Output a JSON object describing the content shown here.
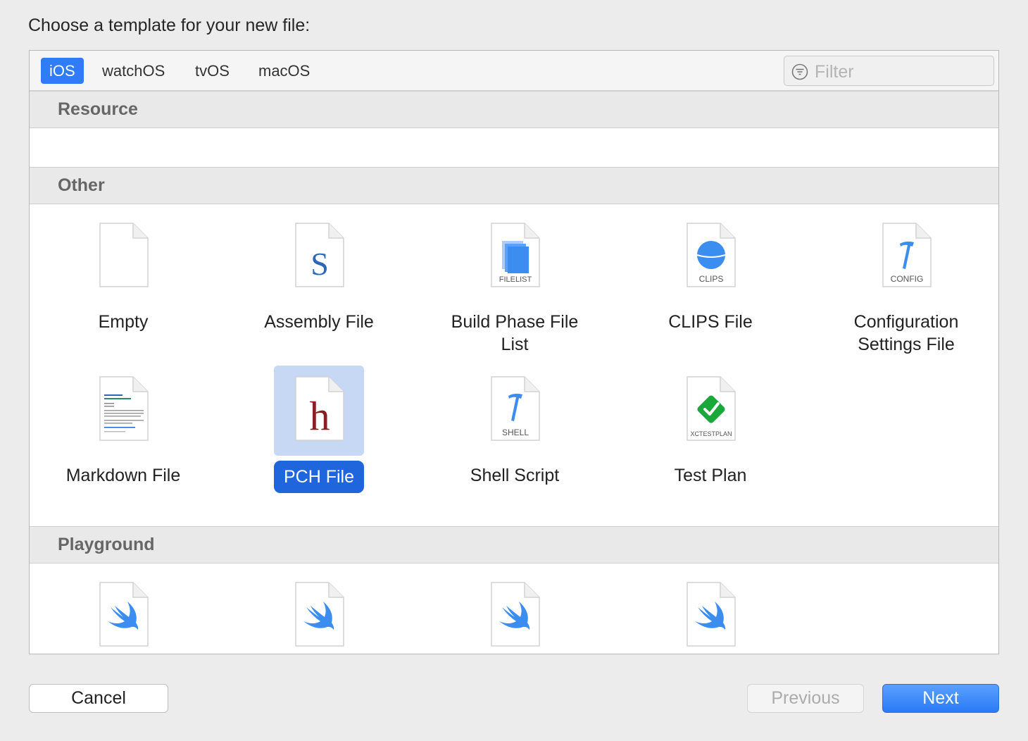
{
  "dialog": {
    "heading": "Choose a template for your new file:"
  },
  "platform_tabs": [
    {
      "label": "iOS",
      "selected": true
    },
    {
      "label": "watchOS",
      "selected": false
    },
    {
      "label": "tvOS",
      "selected": false
    },
    {
      "label": "macOS",
      "selected": false
    }
  ],
  "filter": {
    "placeholder": "Filter"
  },
  "sections": {
    "resource": "Resource",
    "other": "Other",
    "playground": "Playground"
  },
  "other_items": [
    {
      "label": "Empty",
      "icon": "empty-file-icon"
    },
    {
      "label": "Assembly File",
      "icon": "assembly-file-icon",
      "glyph": "S"
    },
    {
      "label": "Build Phase File List",
      "icon": "filelist-file-icon",
      "tag": "FILELIST"
    },
    {
      "label": "CLIPS File",
      "icon": "clips-file-icon",
      "tag": "CLIPS"
    },
    {
      "label": "Configuration Settings File",
      "icon": "config-file-icon",
      "tag": "CONFIG"
    },
    {
      "label": "Markdown File",
      "icon": "markdown-file-icon"
    },
    {
      "label": "PCH File",
      "icon": "pch-file-icon",
      "glyph": "h",
      "selected": true
    },
    {
      "label": "Shell Script",
      "icon": "shell-file-icon",
      "tag": "SHELL"
    },
    {
      "label": "Test Plan",
      "icon": "xctestplan-file-icon",
      "tag": "XCTESTPLAN"
    }
  ],
  "playground_items": [
    {
      "icon": "swift-file-icon"
    },
    {
      "icon": "swift-file-icon"
    },
    {
      "icon": "swift-file-icon"
    },
    {
      "icon": "swift-file-icon"
    }
  ],
  "buttons": {
    "cancel": "Cancel",
    "previous": "Previous",
    "next": "Next"
  },
  "colors": {
    "accent": "#2f7cf6",
    "selection_bg": "#c6d8f3",
    "selection_label": "#1f65dc",
    "pch_glyph": "#8a1e24",
    "assembly_glyph": "#2a67b8",
    "icon_blue": "#3b8ef0",
    "testplan_green": "#1aa83a"
  }
}
